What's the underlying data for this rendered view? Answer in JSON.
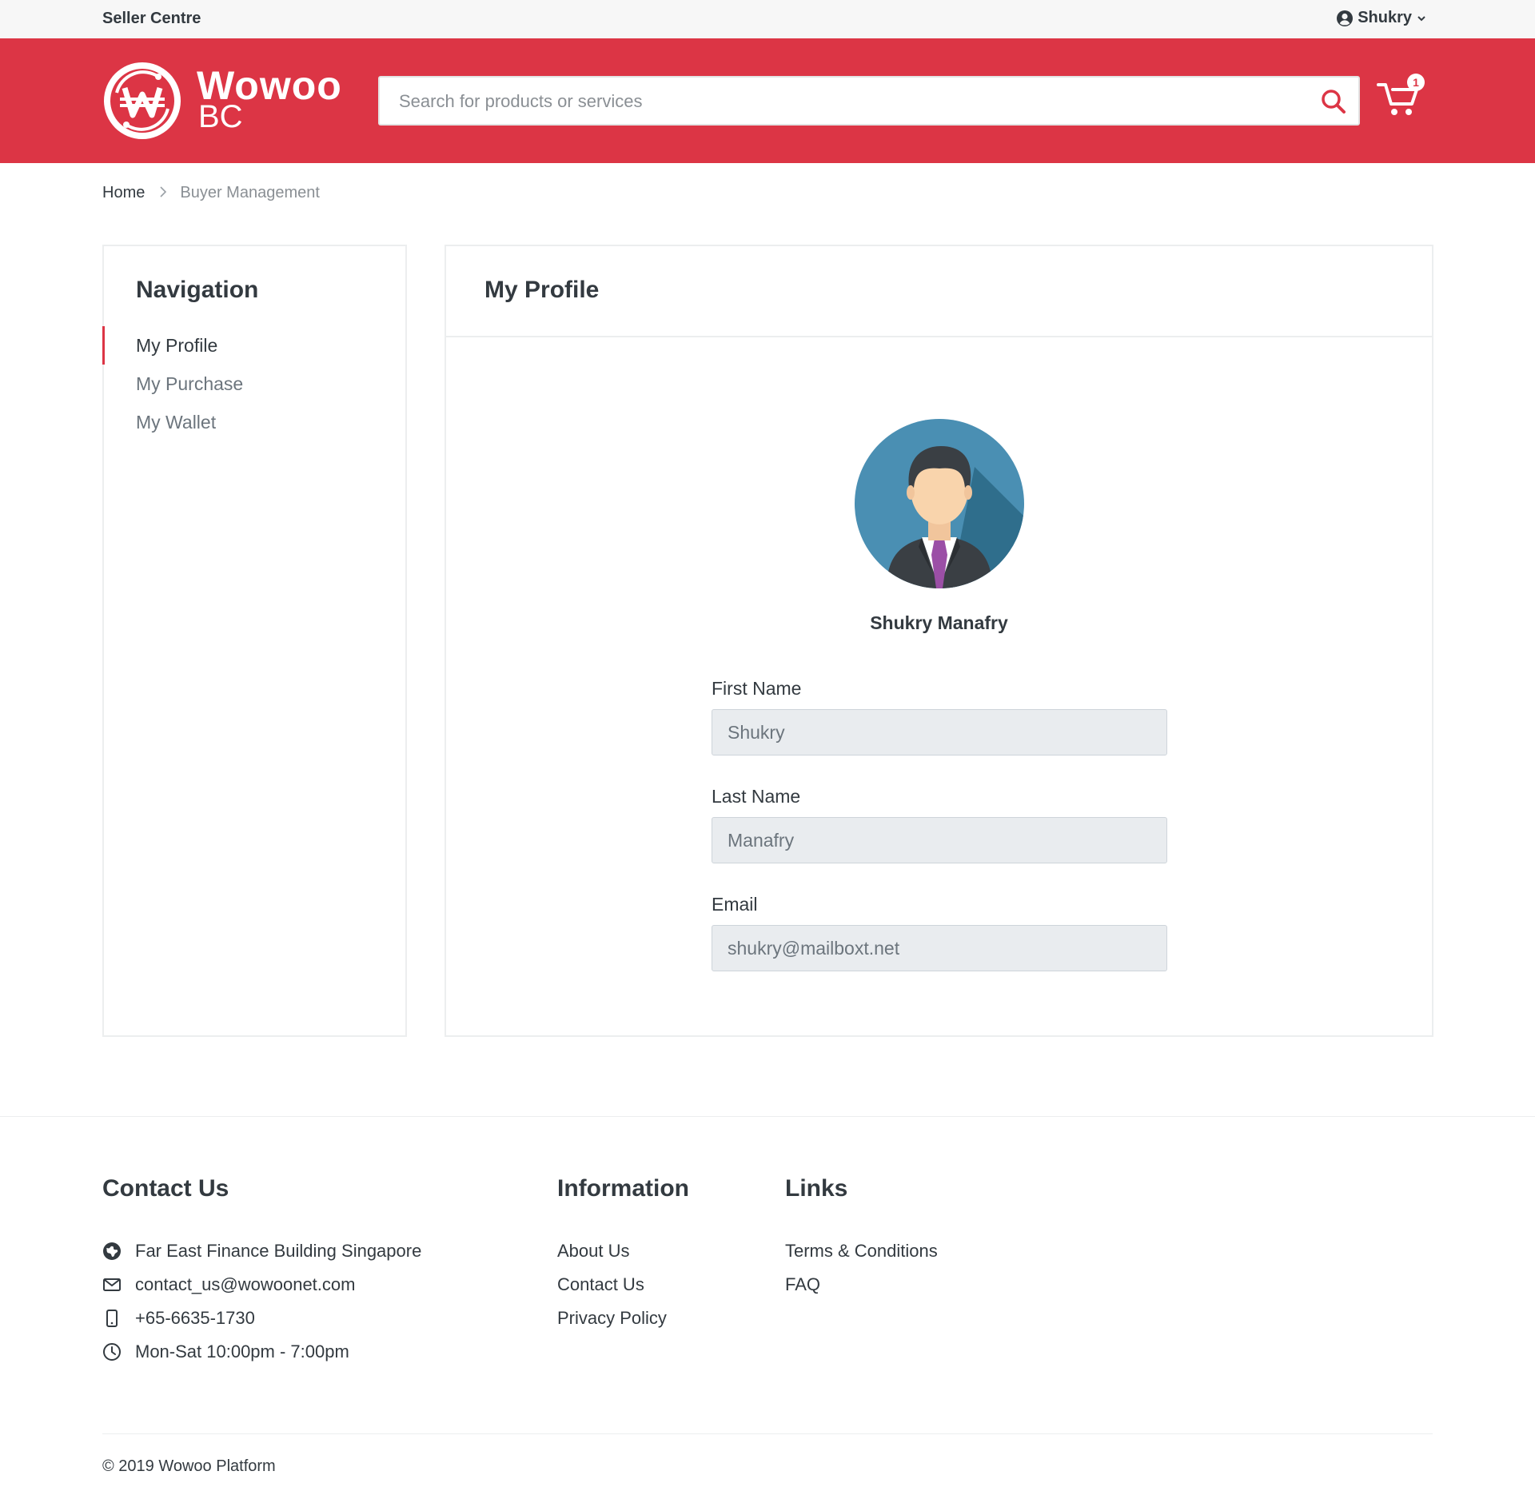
{
  "topbar": {
    "seller_centre": "Seller Centre",
    "user_name": "Shukry",
    "user_icon": "user-circle-icon",
    "dropdown_icon": "chevron-down-icon"
  },
  "header": {
    "brand_name": "Wowoo",
    "brand_suffix": "BC",
    "brand_color": "#dc3545",
    "search_placeholder": "Search for products or services",
    "cart_count": "1"
  },
  "breadcrumb": {
    "home": "Home",
    "separator": ">",
    "current": "Buyer Management"
  },
  "navigation": {
    "title": "Navigation",
    "items": [
      {
        "label": "My Profile",
        "active": true
      },
      {
        "label": "My Purchase",
        "active": false
      },
      {
        "label": "My Wallet",
        "active": false
      }
    ]
  },
  "profile": {
    "title": "My Profile",
    "full_name": "Shukry Manafry",
    "fields": {
      "first_name": {
        "label": "First Name",
        "value": "Shukry"
      },
      "last_name": {
        "label": "Last Name",
        "value": "Manafry"
      },
      "email": {
        "label": "Email",
        "value": "shukry@mailboxt.net"
      }
    }
  },
  "footer": {
    "contact": {
      "title": "Contact Us",
      "address": "Far East Finance Building Singapore",
      "email": "contact_us@wowoonet.com",
      "phone": "+65-6635-1730",
      "hours": "Mon-Sat 10:00pm - 7:00pm"
    },
    "information": {
      "title": "Information",
      "links": [
        "About Us",
        "Contact Us",
        "Privacy Policy"
      ]
    },
    "links": {
      "title": "Links",
      "links": [
        "Terms & Conditions",
        "FAQ"
      ]
    },
    "copyright": "© 2019 Wowoo Platform"
  }
}
